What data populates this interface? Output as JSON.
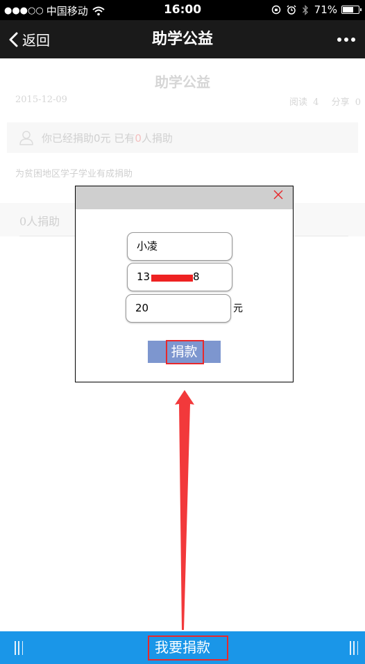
{
  "status_bar": {
    "signal": "●●●○○",
    "carrier": "中国移动",
    "time": "16:00",
    "battery_percent": "71%",
    "battery_level": 0.71,
    "icons": [
      "wifi-icon",
      "rotation-lock-icon",
      "alarm-icon",
      "bluetooth-icon",
      "battery-icon"
    ]
  },
  "nav": {
    "back_label": "返回",
    "title": "助学公益",
    "more_icon": "more-dots-icon"
  },
  "article": {
    "title": "助学公益",
    "date": "2015-12-09",
    "read_label": "阅读",
    "read_count": "4",
    "share_label": "分享",
    "share_count": "0",
    "donated_prefix": "你已经捐助0元 已有",
    "donated_count": "0",
    "donated_suffix": "人捐助",
    "description": "为贫困地区学子学业有成捐助",
    "donors_label": "0人捐助"
  },
  "modal": {
    "close_icon": "close-icon",
    "name_value": "小凌",
    "phone_prefix": "13",
    "phone_suffix": "8",
    "amount_value": "20",
    "amount_unit": "元",
    "donate_label": "捐款"
  },
  "bottom_bar": {
    "donate_label": "我要捐款"
  },
  "colors": {
    "bottom_bar": "#1a96e8",
    "donate_button": "#7d96cf",
    "highlight": "#e8282b",
    "nav_bar": "#1a1a1a"
  }
}
